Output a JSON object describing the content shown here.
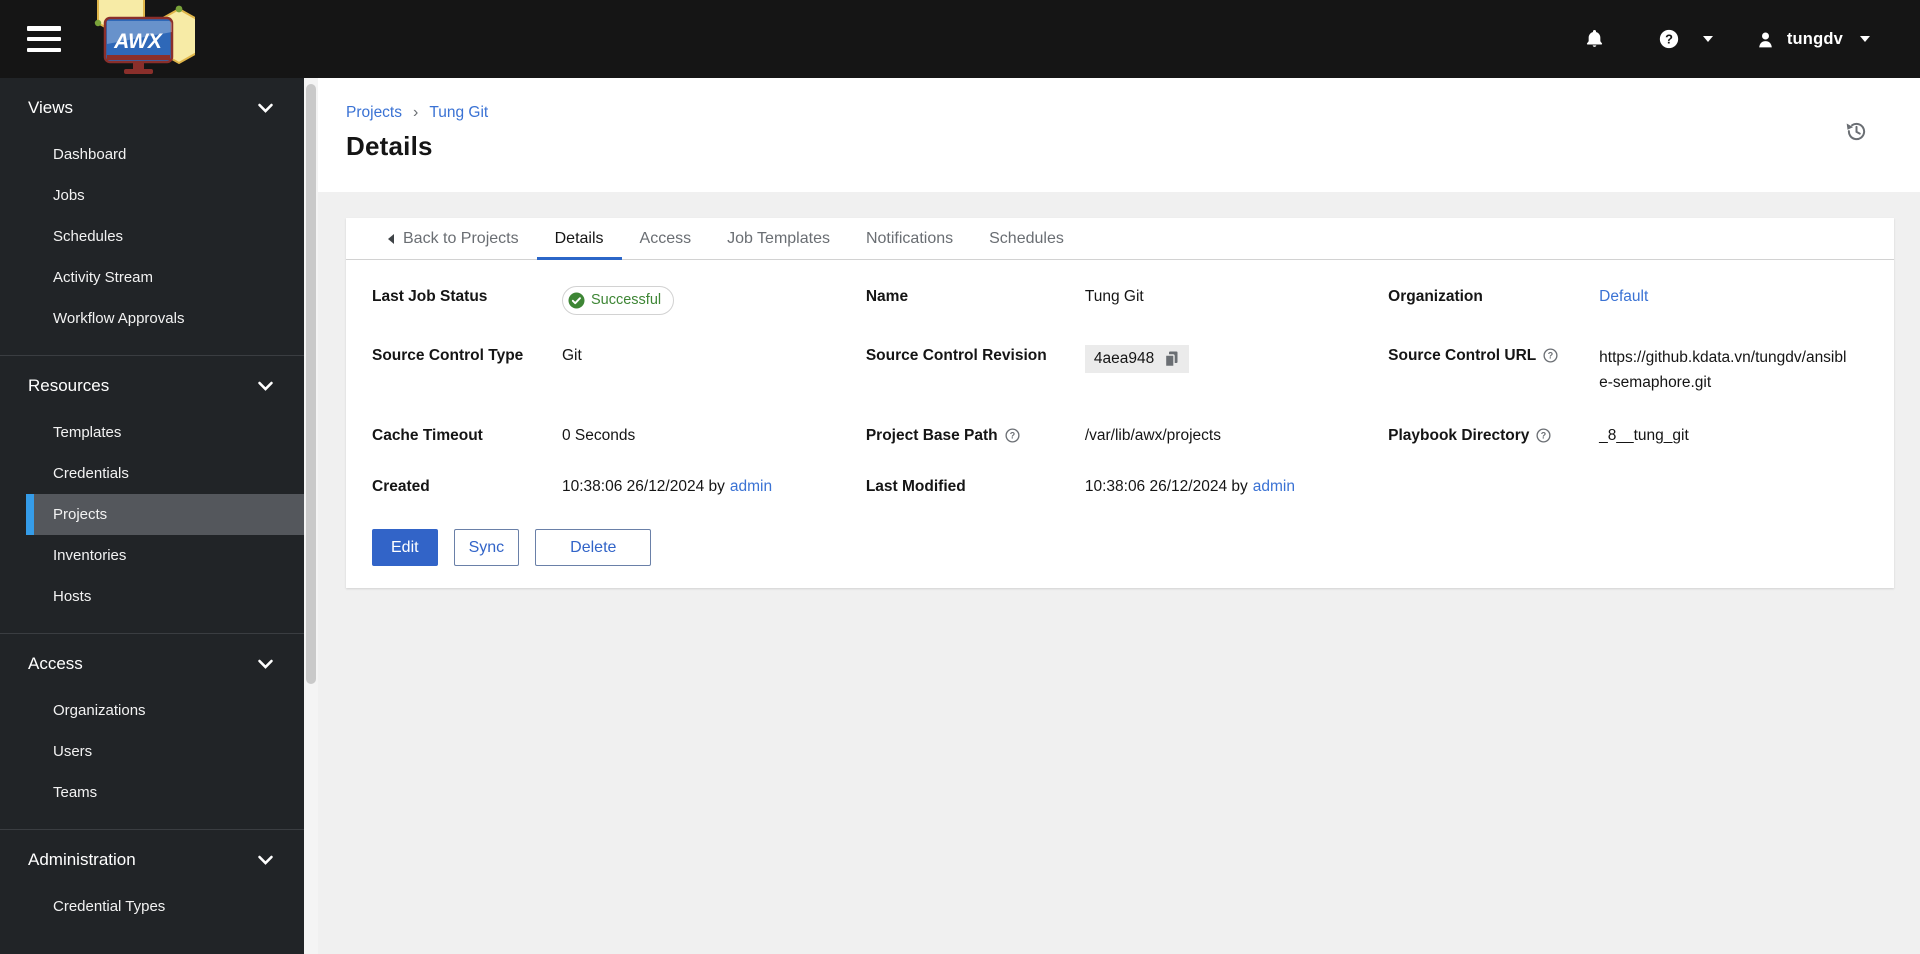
{
  "navbar": {
    "logo_text": "AWX",
    "user_name": "tungdv"
  },
  "sidebar": {
    "sections": [
      {
        "label": "Views",
        "items": [
          "Dashboard",
          "Jobs",
          "Schedules",
          "Activity Stream",
          "Workflow Approvals"
        ]
      },
      {
        "label": "Resources",
        "items": [
          "Templates",
          "Credentials",
          "Projects",
          "Inventories",
          "Hosts"
        ],
        "active_item": "Projects"
      },
      {
        "label": "Access",
        "items": [
          "Organizations",
          "Users",
          "Teams"
        ]
      },
      {
        "label": "Administration",
        "items": [
          "Credential Types"
        ]
      }
    ]
  },
  "breadcrumb": {
    "items": [
      "Projects",
      "Tung Git"
    ]
  },
  "page": {
    "title": "Details"
  },
  "tabs": {
    "back": "Back to Projects",
    "items": [
      "Details",
      "Access",
      "Job Templates",
      "Notifications",
      "Schedules"
    ],
    "active": "Details"
  },
  "details": {
    "last_job_status": {
      "label": "Last Job Status",
      "value": "Successful"
    },
    "name": {
      "label": "Name",
      "value": "Tung Git"
    },
    "organization": {
      "label": "Organization",
      "value": "Default"
    },
    "source_control_type": {
      "label": "Source Control Type",
      "value": "Git"
    },
    "source_control_revision": {
      "label": "Source Control Revision",
      "value": "4aea948"
    },
    "source_control_url": {
      "label": "Source Control URL",
      "value": "https://github.kdata.vn/tungdv/ansible-semaphore.git"
    },
    "cache_timeout": {
      "label": "Cache Timeout",
      "value": "0 Seconds"
    },
    "project_base_path": {
      "label": "Project Base Path",
      "value": "/var/lib/awx/projects"
    },
    "playbook_directory": {
      "label": "Playbook Directory",
      "value": "_8__tung_git"
    },
    "created": {
      "label": "Created",
      "value": "10:38:06 26/12/2024 by",
      "link": "admin"
    },
    "last_modified": {
      "label": "Last Modified",
      "value": "10:38:06 26/12/2024 by",
      "link": "admin"
    }
  },
  "actions": {
    "edit": "Edit",
    "sync": "Sync",
    "delete": "Delete"
  },
  "colors": {
    "masthead_bg": "#151515",
    "sidebar_bg": "#212427",
    "active_nav_bg": "#54575c",
    "active_nav_bar": "#359ce8",
    "accent_blue": "#3264c8",
    "link_blue": "#3a72d4",
    "success_green": "#3e8635",
    "page_bg": "#f0f0f0",
    "tab_underline": "#2b66c8"
  }
}
